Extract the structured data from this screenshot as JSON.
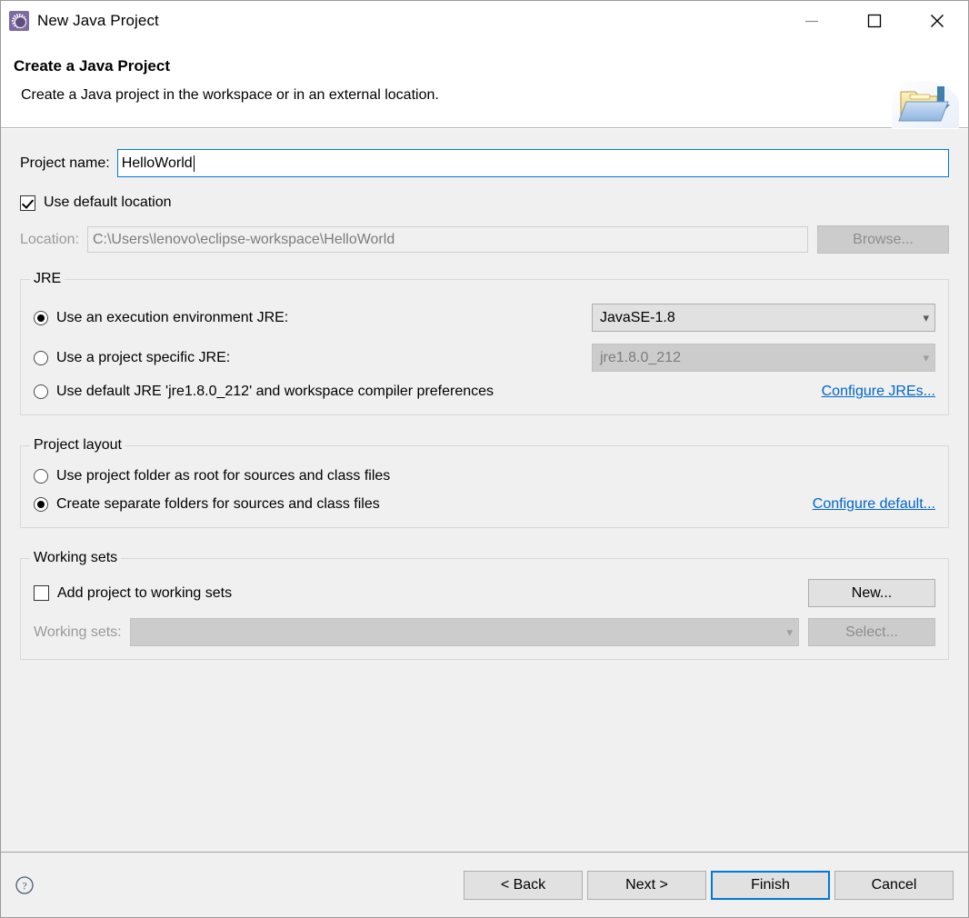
{
  "window": {
    "title": "New Java Project",
    "icon": "eclipse-wizard-icon",
    "minimize_label": "–",
    "maximize_label": "□",
    "close_label": "✕"
  },
  "banner": {
    "title": "Create a Java Project",
    "description": "Create a Java project in the workspace or in an external location.",
    "icon": "new-java-project-folder-icon"
  },
  "form": {
    "project_name_label": "Project name:",
    "project_name_value": "HelloWorld",
    "project_name_placeholder": "",
    "use_default_location_label": "Use default location",
    "use_default_location_checked": true,
    "location_label": "Location:",
    "location_value": "C:\\Users\\lenovo\\eclipse-workspace\\HelloWorld",
    "browse_label": "Browse..."
  },
  "jre": {
    "group_title": "JRE",
    "option_execution_env_label": "Use an execution environment JRE:",
    "option_execution_env_selected": true,
    "execution_env_value": "JavaSE-1.8",
    "option_project_specific_label": "Use a project specific JRE:",
    "option_project_specific_selected": false,
    "project_specific_value": "jre1.8.0_212",
    "option_default_jre_label": "Use default JRE 'jre1.8.0_212' and workspace compiler preferences",
    "option_default_jre_selected": false,
    "configure_jres_link": "Configure JREs..."
  },
  "project_layout": {
    "group_title": "Project layout",
    "option_root_label": "Use project folder as root for sources and class files",
    "option_root_selected": false,
    "option_separate_label": "Create separate folders for sources and class files",
    "option_separate_selected": true,
    "configure_default_link": "Configure default..."
  },
  "working_sets": {
    "group_title": "Working sets",
    "add_project_label": "Add project to working sets",
    "add_project_checked": false,
    "new_label": "New...",
    "working_sets_label": "Working sets:",
    "working_sets_value": "",
    "select_label": "Select..."
  },
  "footer": {
    "help_icon": "help-icon",
    "back_label": "< Back",
    "next_label": "Next >",
    "finish_label": "Finish",
    "cancel_label": "Cancel"
  },
  "colors": {
    "accent": "#0078d7",
    "link": "#0066cc",
    "dialog_bg": "#f0f0f0",
    "header_bg": "#ffffff",
    "disabled_text": "#7c7c7c"
  }
}
